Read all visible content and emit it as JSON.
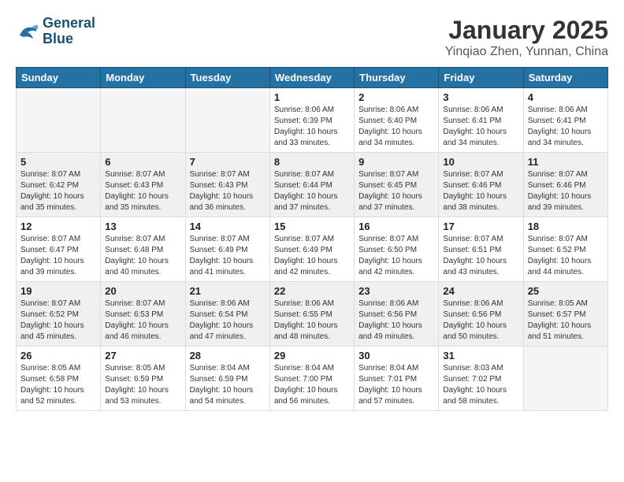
{
  "logo": {
    "line1": "General",
    "line2": "Blue"
  },
  "title": "January 2025",
  "subtitle": "Yinqiao Zhen, Yunnan, China",
  "weekdays": [
    "Sunday",
    "Monday",
    "Tuesday",
    "Wednesday",
    "Thursday",
    "Friday",
    "Saturday"
  ],
  "weeks": [
    [
      {
        "day": "",
        "info": ""
      },
      {
        "day": "",
        "info": ""
      },
      {
        "day": "",
        "info": ""
      },
      {
        "day": "1",
        "info": "Sunrise: 8:06 AM\nSunset: 6:39 PM\nDaylight: 10 hours\nand 33 minutes."
      },
      {
        "day": "2",
        "info": "Sunrise: 8:06 AM\nSunset: 6:40 PM\nDaylight: 10 hours\nand 34 minutes."
      },
      {
        "day": "3",
        "info": "Sunrise: 8:06 AM\nSunset: 6:41 PM\nDaylight: 10 hours\nand 34 minutes."
      },
      {
        "day": "4",
        "info": "Sunrise: 8:06 AM\nSunset: 6:41 PM\nDaylight: 10 hours\nand 34 minutes."
      }
    ],
    [
      {
        "day": "5",
        "info": "Sunrise: 8:07 AM\nSunset: 6:42 PM\nDaylight: 10 hours\nand 35 minutes."
      },
      {
        "day": "6",
        "info": "Sunrise: 8:07 AM\nSunset: 6:43 PM\nDaylight: 10 hours\nand 35 minutes."
      },
      {
        "day": "7",
        "info": "Sunrise: 8:07 AM\nSunset: 6:43 PM\nDaylight: 10 hours\nand 36 minutes."
      },
      {
        "day": "8",
        "info": "Sunrise: 8:07 AM\nSunset: 6:44 PM\nDaylight: 10 hours\nand 37 minutes."
      },
      {
        "day": "9",
        "info": "Sunrise: 8:07 AM\nSunset: 6:45 PM\nDaylight: 10 hours\nand 37 minutes."
      },
      {
        "day": "10",
        "info": "Sunrise: 8:07 AM\nSunset: 6:46 PM\nDaylight: 10 hours\nand 38 minutes."
      },
      {
        "day": "11",
        "info": "Sunrise: 8:07 AM\nSunset: 6:46 PM\nDaylight: 10 hours\nand 39 minutes."
      }
    ],
    [
      {
        "day": "12",
        "info": "Sunrise: 8:07 AM\nSunset: 6:47 PM\nDaylight: 10 hours\nand 39 minutes."
      },
      {
        "day": "13",
        "info": "Sunrise: 8:07 AM\nSunset: 6:48 PM\nDaylight: 10 hours\nand 40 minutes."
      },
      {
        "day": "14",
        "info": "Sunrise: 8:07 AM\nSunset: 6:49 PM\nDaylight: 10 hours\nand 41 minutes."
      },
      {
        "day": "15",
        "info": "Sunrise: 8:07 AM\nSunset: 6:49 PM\nDaylight: 10 hours\nand 42 minutes."
      },
      {
        "day": "16",
        "info": "Sunrise: 8:07 AM\nSunset: 6:50 PM\nDaylight: 10 hours\nand 42 minutes."
      },
      {
        "day": "17",
        "info": "Sunrise: 8:07 AM\nSunset: 6:51 PM\nDaylight: 10 hours\nand 43 minutes."
      },
      {
        "day": "18",
        "info": "Sunrise: 8:07 AM\nSunset: 6:52 PM\nDaylight: 10 hours\nand 44 minutes."
      }
    ],
    [
      {
        "day": "19",
        "info": "Sunrise: 8:07 AM\nSunset: 6:52 PM\nDaylight: 10 hours\nand 45 minutes."
      },
      {
        "day": "20",
        "info": "Sunrise: 8:07 AM\nSunset: 6:53 PM\nDaylight: 10 hours\nand 46 minutes."
      },
      {
        "day": "21",
        "info": "Sunrise: 8:06 AM\nSunset: 6:54 PM\nDaylight: 10 hours\nand 47 minutes."
      },
      {
        "day": "22",
        "info": "Sunrise: 8:06 AM\nSunset: 6:55 PM\nDaylight: 10 hours\nand 48 minutes."
      },
      {
        "day": "23",
        "info": "Sunrise: 8:06 AM\nSunset: 6:56 PM\nDaylight: 10 hours\nand 49 minutes."
      },
      {
        "day": "24",
        "info": "Sunrise: 8:06 AM\nSunset: 6:56 PM\nDaylight: 10 hours\nand 50 minutes."
      },
      {
        "day": "25",
        "info": "Sunrise: 8:05 AM\nSunset: 6:57 PM\nDaylight: 10 hours\nand 51 minutes."
      }
    ],
    [
      {
        "day": "26",
        "info": "Sunrise: 8:05 AM\nSunset: 6:58 PM\nDaylight: 10 hours\nand 52 minutes."
      },
      {
        "day": "27",
        "info": "Sunrise: 8:05 AM\nSunset: 6:59 PM\nDaylight: 10 hours\nand 53 minutes."
      },
      {
        "day": "28",
        "info": "Sunrise: 8:04 AM\nSunset: 6:59 PM\nDaylight: 10 hours\nand 54 minutes."
      },
      {
        "day": "29",
        "info": "Sunrise: 8:04 AM\nSunset: 7:00 PM\nDaylight: 10 hours\nand 56 minutes."
      },
      {
        "day": "30",
        "info": "Sunrise: 8:04 AM\nSunset: 7:01 PM\nDaylight: 10 hours\nand 57 minutes."
      },
      {
        "day": "31",
        "info": "Sunrise: 8:03 AM\nSunset: 7:02 PM\nDaylight: 10 hours\nand 58 minutes."
      },
      {
        "day": "",
        "info": ""
      }
    ]
  ]
}
